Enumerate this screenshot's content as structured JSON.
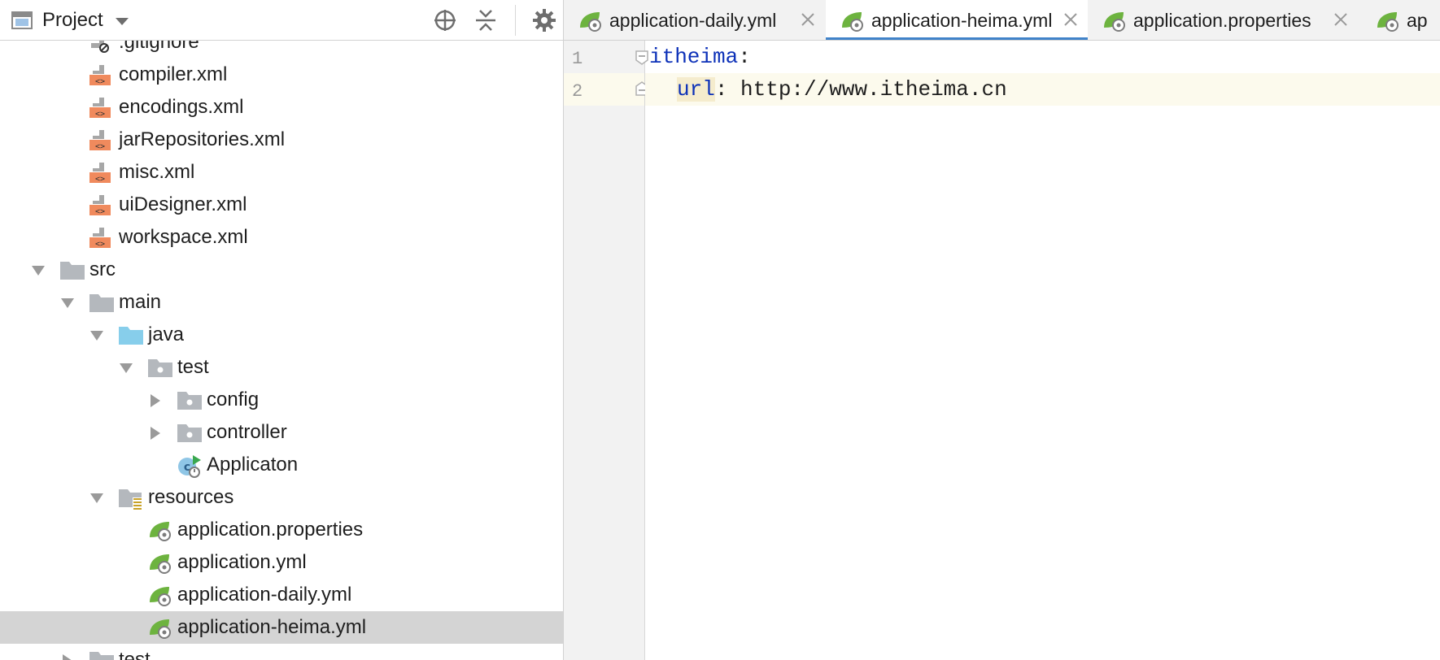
{
  "project_panel": {
    "title": "Project",
    "toolbar": {
      "locate_icon": "crosshair-icon",
      "collapse_icon": "collapse-all-icon",
      "settings_icon": "gear-icon",
      "hide_icon": "minimize-icon"
    },
    "tree": [
      {
        "label": ".gitignore",
        "icon": "gitignore-file-icon",
        "expanded": null,
        "selected": false
      },
      {
        "label": "compiler.xml",
        "icon": "xml-file-icon",
        "expanded": null,
        "selected": false
      },
      {
        "label": "encodings.xml",
        "icon": "xml-file-icon",
        "expanded": null,
        "selected": false
      },
      {
        "label": "jarRepositories.xml",
        "icon": "xml-file-icon",
        "expanded": null,
        "selected": false
      },
      {
        "label": "misc.xml",
        "icon": "xml-file-icon",
        "expanded": null,
        "selected": false
      },
      {
        "label": "uiDesigner.xml",
        "icon": "xml-file-icon",
        "expanded": null,
        "selected": false
      },
      {
        "label": "workspace.xml",
        "icon": "xml-file-icon",
        "expanded": null,
        "selected": false
      },
      {
        "label": "src",
        "icon": "folder-icon",
        "expanded": true,
        "selected": false
      },
      {
        "label": "main",
        "icon": "folder-icon",
        "expanded": true,
        "selected": false
      },
      {
        "label": "java",
        "icon": "source-root-folder-icon",
        "expanded": true,
        "selected": false
      },
      {
        "label": "test",
        "icon": "package-icon",
        "expanded": true,
        "selected": false
      },
      {
        "label": "config",
        "icon": "package-icon",
        "expanded": false,
        "selected": false
      },
      {
        "label": "controller",
        "icon": "package-icon",
        "expanded": false,
        "selected": false
      },
      {
        "label": "Applicaton",
        "icon": "spring-boot-class-icon",
        "expanded": null,
        "selected": false
      },
      {
        "label": "resources",
        "icon": "resources-folder-icon",
        "expanded": true,
        "selected": false
      },
      {
        "label": "application.properties",
        "icon": "spring-config-icon",
        "expanded": null,
        "selected": false
      },
      {
        "label": "application.yml",
        "icon": "spring-config-icon",
        "expanded": null,
        "selected": false
      },
      {
        "label": "application-daily.yml",
        "icon": "spring-config-icon",
        "expanded": null,
        "selected": false
      },
      {
        "label": "application-heima.yml",
        "icon": "spring-config-icon",
        "expanded": null,
        "selected": true
      },
      {
        "label": "test",
        "icon": "folder-icon",
        "expanded": false,
        "selected": false
      }
    ]
  },
  "editor": {
    "tabs": [
      {
        "label": "application-daily.yml",
        "icon": "spring-config-icon",
        "active": false,
        "closable": true
      },
      {
        "label": "application-heima.yml",
        "icon": "spring-config-icon",
        "active": true,
        "closable": true
      },
      {
        "label": "application.properties",
        "icon": "spring-config-icon",
        "active": false,
        "closable": true
      },
      {
        "label": "ap",
        "icon": "spring-config-icon",
        "active": false,
        "closable": false
      }
    ],
    "lines": [
      {
        "number": "1",
        "key": "itheima",
        "sep": ":",
        "value": ""
      },
      {
        "number": "2",
        "key": "url",
        "sep": ":",
        "value": " http://www.itheima.cn"
      }
    ],
    "current_line": 2
  },
  "colors": {
    "accent": "#4083c9",
    "selection": "#d4d4d4",
    "yaml_key": "#0d31b8",
    "xml_icon": "#f08a5d",
    "folder": "#b4b8bd",
    "source_folder": "#87ceeb",
    "spring_green": "#6db33f"
  }
}
